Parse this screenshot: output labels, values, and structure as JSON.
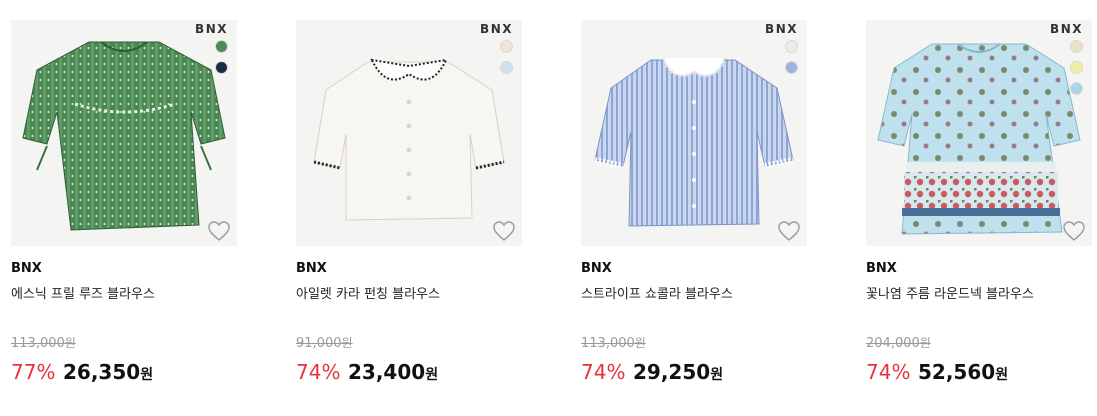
{
  "products": [
    {
      "brand_logo": "BNX",
      "brand": "BNX",
      "name": "에스닉 프릴 루즈 블라우스",
      "original_price": "113,000",
      "discount": "77%",
      "price": "26,350",
      "currency": "원",
      "swatch_colors": [
        "#4f8a55",
        "#1f2a44"
      ],
      "wish_icon": "heart-outline-icon"
    },
    {
      "brand_logo": "BNX",
      "brand": "BNX",
      "name": "아일렛 카라 펀칭 블라우스",
      "original_price": "91,000",
      "discount": "74%",
      "price": "23,400",
      "currency": "원",
      "swatch_colors": [
        "#efe4d8",
        "#cfe0ef"
      ],
      "wish_icon": "heart-outline-icon"
    },
    {
      "brand_logo": "BNX",
      "brand": "BNX",
      "name": "스트라이프 쇼콜라 블라우스",
      "original_price": "113,000",
      "discount": "74%",
      "price": "29,250",
      "currency": "원",
      "swatch_colors": [
        "#ecebea",
        "#9fb3dc"
      ],
      "wish_icon": "heart-outline-icon"
    },
    {
      "brand_logo": "BNX",
      "brand": "BNX",
      "name": "꽃나염 주름 라운드넥 블라우스",
      "original_price": "204,000",
      "discount": "74%",
      "price": "52,560",
      "currency": "원",
      "swatch_colors": [
        "#e9e1c7",
        "#eef0a2",
        "#a8d6e6"
      ],
      "wish_icon": "heart-outline-icon"
    }
  ],
  "colors": {
    "discount": "#e8323c",
    "original_price": "#9a9a9a",
    "thumb_bg": "#f4f4f2"
  }
}
